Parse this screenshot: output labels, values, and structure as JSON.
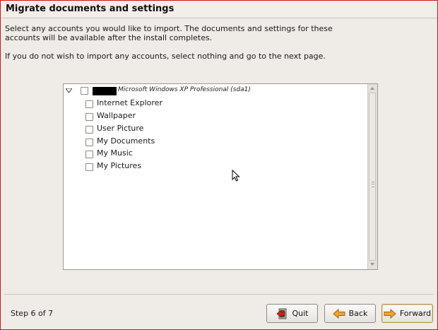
{
  "header": {
    "title": "Migrate documents and settings"
  },
  "intro": {
    "paragraph1": "Select any accounts you would like to import.  The documents and settings for these\naccounts will be available after the install completes.",
    "paragraph2": "If you do not wish to import any accounts, select nothing and go to the next page."
  },
  "tree": {
    "root": {
      "label": "Microsoft Windows XP Professional (sda1)",
      "expanded": true,
      "checked": false
    },
    "items": [
      {
        "label": "Internet Explorer",
        "checked": false
      },
      {
        "label": "Wallpaper",
        "checked": false
      },
      {
        "label": "User Picture",
        "checked": false
      },
      {
        "label": "My Documents",
        "checked": false
      },
      {
        "label": "My Music",
        "checked": false
      },
      {
        "label": "My Pictures",
        "checked": false
      }
    ]
  },
  "footer": {
    "step": "Step 6 of 7",
    "quit_label": "Quit",
    "back_label": "Back",
    "forward_label": "Forward"
  },
  "colors": {
    "window_border": "#c81818",
    "background": "#efebe7",
    "forward_focus": "#a99060"
  }
}
